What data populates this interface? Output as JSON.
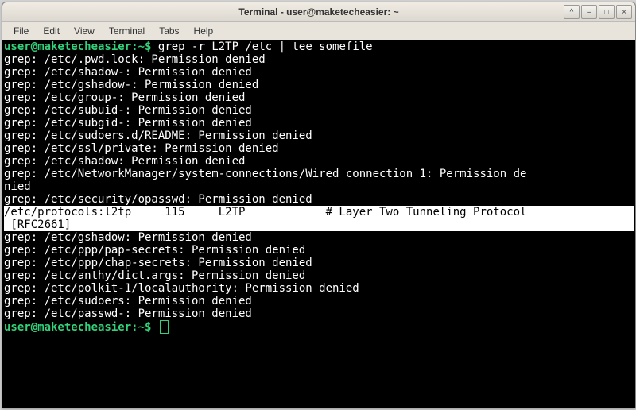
{
  "window": {
    "title": "Terminal - user@maketecheasier: ~"
  },
  "menubar": {
    "items": [
      "File",
      "Edit",
      "View",
      "Terminal",
      "Tabs",
      "Help"
    ]
  },
  "prompt": {
    "user_host": "user@maketecheasier",
    "separator": ":",
    "path": "~",
    "symbol": "$"
  },
  "command": "grep -r L2TP /etc | tee somefile",
  "output_before": [
    "grep: /etc/.pwd.lock: Permission denied",
    "grep: /etc/shadow-: Permission denied",
    "grep: /etc/gshadow-: Permission denied",
    "grep: /etc/group-: Permission denied",
    "grep: /etc/subuid-: Permission denied",
    "grep: /etc/subgid-: Permission denied",
    "grep: /etc/sudoers.d/README: Permission denied",
    "grep: /etc/ssl/private: Permission denied",
    "grep: /etc/shadow: Permission denied",
    "grep: /etc/NetworkManager/system-connections/Wired connection 1: Permission de",
    "nied",
    "grep: /etc/security/opasswd: Permission denied"
  ],
  "highlighted": [
    "/etc/protocols:l2tp     115     L2TP            # Layer Two Tunneling Protocol",
    " [RFC2661]                                                                     "
  ],
  "output_after": [
    "grep: /etc/gshadow: Permission denied",
    "grep: /etc/ppp/pap-secrets: Permission denied",
    "grep: /etc/ppp/chap-secrets: Permission denied",
    "grep: /etc/anthy/dict.args: Permission denied",
    "grep: /etc/polkit-1/localauthority: Permission denied",
    "grep: /etc/sudoers: Permission denied",
    "grep: /etc/passwd-: Permission denied"
  ]
}
